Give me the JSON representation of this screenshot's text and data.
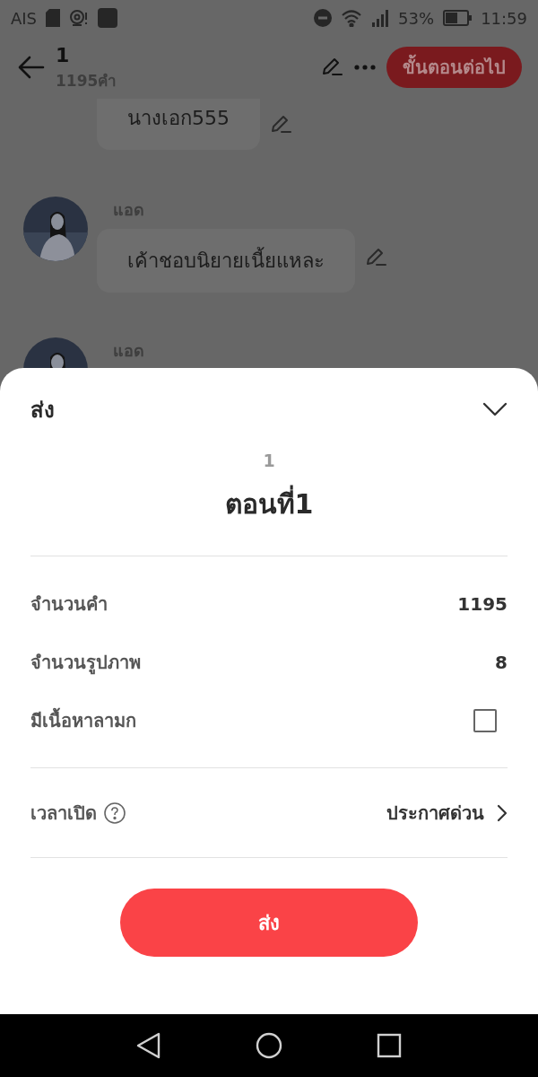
{
  "status_bar": {
    "carrier": "AIS",
    "battery": "53%",
    "time": "11:59"
  },
  "header": {
    "title": "1",
    "subtitle": "1195คำ",
    "next_button": "ขั้นตอนต่อไป"
  },
  "messages": [
    {
      "text": "นางเอก555"
    },
    {
      "sender": "แอด",
      "text": "เค้าชอบนิยายเนี้ยแหละ"
    },
    {
      "sender": "แอด"
    }
  ],
  "sheet": {
    "title": "ส่ง",
    "episode_number": "1",
    "episode_title": "ตอนที่1",
    "stats": [
      {
        "kind": "value",
        "label": "จำนวนคำ",
        "value": "1195"
      },
      {
        "kind": "value",
        "label": "จำนวนรูปภาพ",
        "value": "8"
      },
      {
        "kind": "checkbox",
        "label": "มีเนื้อหาลามก",
        "checked": false
      }
    ],
    "schedule": {
      "label": "เวลาเปิด",
      "value": "ประกาศด่วน"
    },
    "submit_button": "ส่ง"
  }
}
